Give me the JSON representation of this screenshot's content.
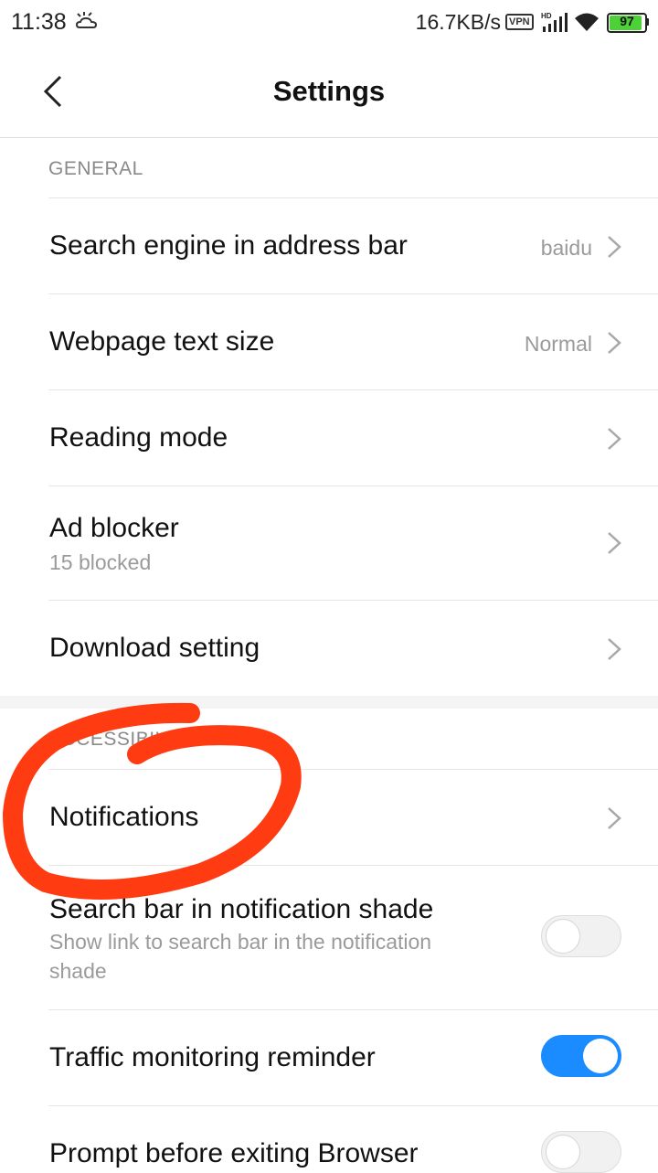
{
  "status_bar": {
    "time": "11:38",
    "net_speed": "16.7KB/s",
    "vpn": "VPN",
    "battery": "97",
    "icons": [
      "weather-icon",
      "signal-icon",
      "wifi-icon",
      "battery-icon"
    ]
  },
  "header": {
    "title": "Settings",
    "back_icon": "chevron-left-icon"
  },
  "general": {
    "header": "GENERAL",
    "items": [
      {
        "title": "Search engine in address bar",
        "value": "baidu"
      },
      {
        "title": "Webpage text size",
        "value": "Normal"
      },
      {
        "title": "Reading mode"
      },
      {
        "title": "Ad blocker",
        "subtitle": "15 blocked"
      },
      {
        "title": "Download setting"
      }
    ]
  },
  "accessibility": {
    "header": "ACCESSIBILITY",
    "items": [
      {
        "title": "Notifications"
      },
      {
        "title": "Search bar in notification shade",
        "subtitle": "Show link to search bar in the notification shade",
        "toggle": false
      },
      {
        "title": "Traffic monitoring reminder",
        "toggle": true
      },
      {
        "title": "Prompt before exiting Browser",
        "toggle": false
      }
    ]
  },
  "colors": {
    "toggle_on": "#1a8cff",
    "annotation": "#ff3b12",
    "battery_fill": "#4cd137"
  }
}
